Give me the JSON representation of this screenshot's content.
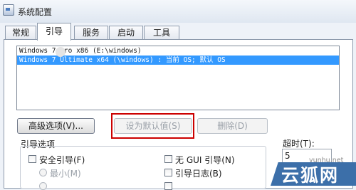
{
  "window": {
    "title": "系统配置"
  },
  "tabs": [
    {
      "label": "常规"
    },
    {
      "label": "引导"
    },
    {
      "label": "服务"
    },
    {
      "label": "启动"
    },
    {
      "label": "工具"
    }
  ],
  "os_list": [
    {
      "text": "Windows 7 Pro x86 (E:\\windows)",
      "selected": false
    },
    {
      "text": "Windows 7 Ultimate x64 (\\windows) : 当前 OS; 默认 OS",
      "selected": true
    }
  ],
  "buttons": {
    "advanced": "高级选项(V)...",
    "set_default": "设为默认值(S)",
    "delete": "删除(D)"
  },
  "boot_options": {
    "group_label": "引导选项",
    "safe_boot": "安全引导(F)",
    "minimal": "最小(M)",
    "no_gui": "无 GUI 引导(N)",
    "boot_log": "引导日志(B)"
  },
  "timeout": {
    "label": "超时(T):",
    "value": "5"
  },
  "watermark": {
    "url": "yunhu.net",
    "logo": "云狐网"
  },
  "colors": {
    "selection": "#3399ff",
    "highlight_box": "#cc0000",
    "watermark": "#3c6fa9"
  }
}
